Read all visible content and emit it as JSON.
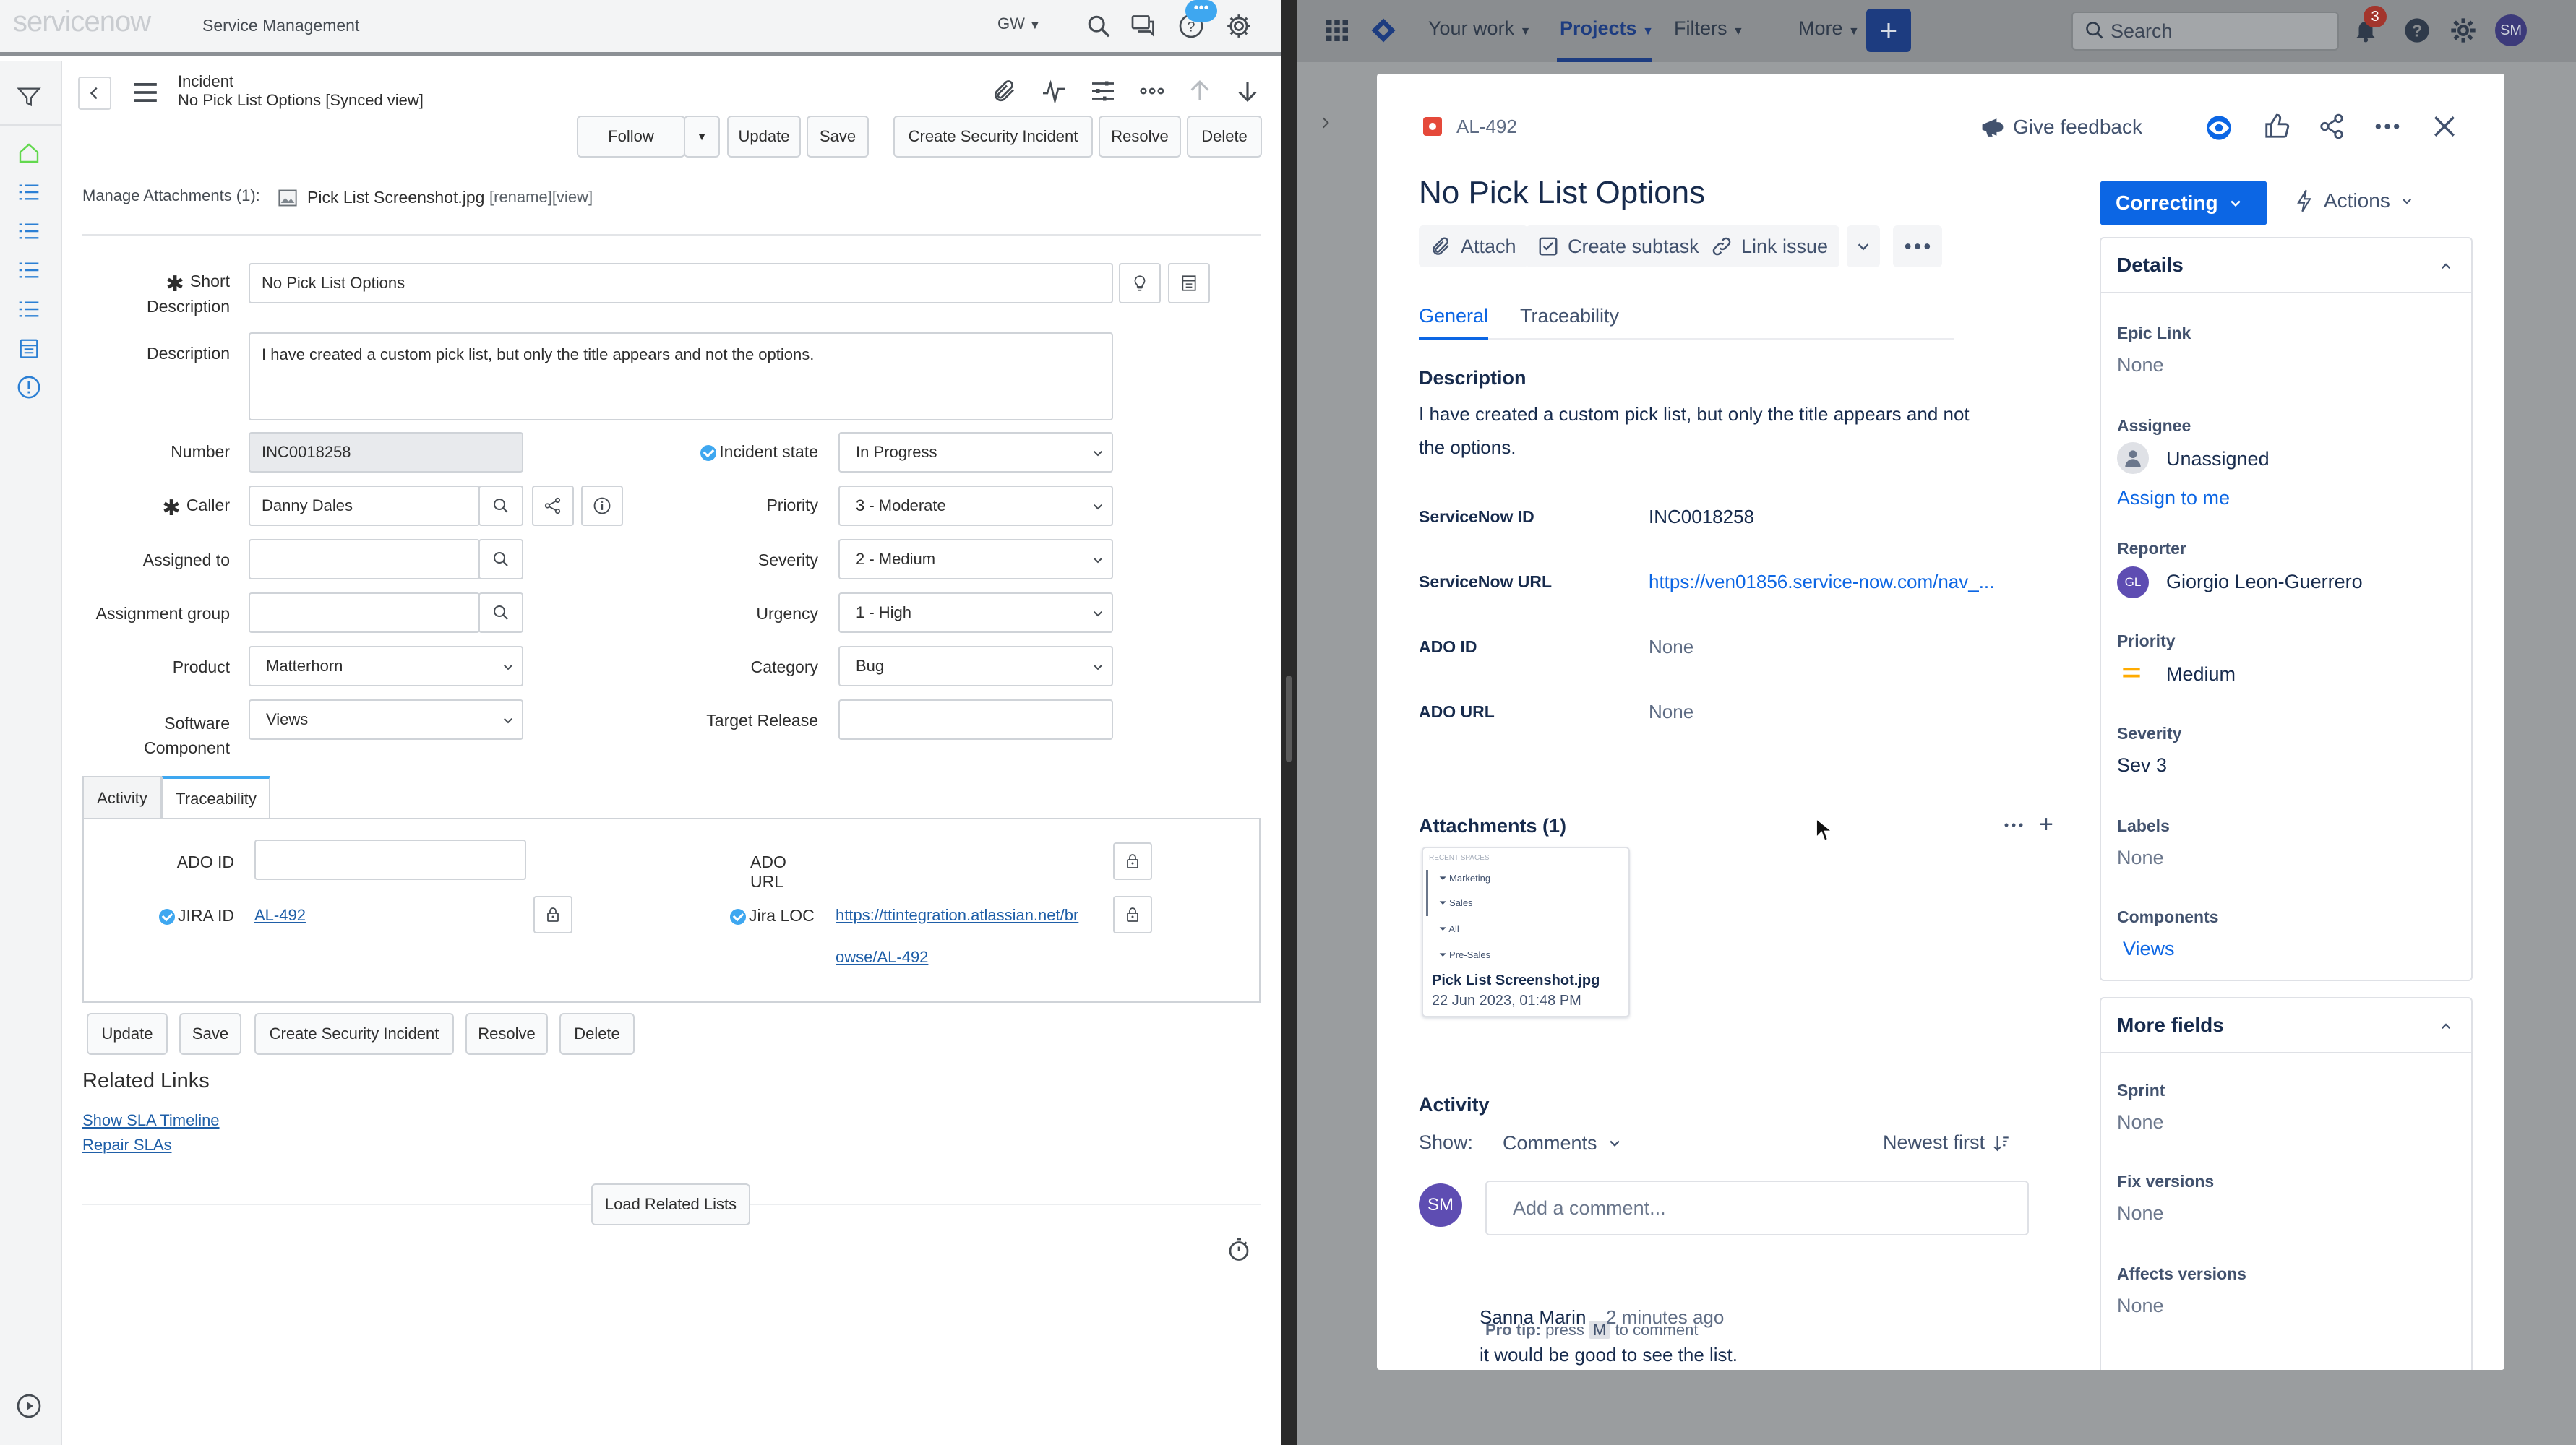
{
  "servicenow": {
    "logo": "servicenow",
    "app_title": "Service Management",
    "user_initials": "GW",
    "chat_badge": "•••",
    "record_type": "Incident",
    "record_name": "No Pick List Options [Synced view]",
    "header_buttons": {
      "follow": "Follow",
      "update": "Update",
      "save": "Save",
      "create_security_incident": "Create Security Incident",
      "resolve": "Resolve",
      "delete": "Delete"
    },
    "attachments": {
      "label": "Manage Attachments (1):",
      "file": "Pick List Screenshot.jpg",
      "actions": "[rename][view]"
    },
    "form": {
      "short_description_label": "Short Description",
      "short_description_value": "No Pick List Options",
      "description_label": "Description",
      "description_value": "I have created a custom pick list, but only the title appears and not the options.",
      "number_label": "Number",
      "number_value": "INC0018258",
      "caller_label": "Caller",
      "caller_value": "Danny Dales",
      "assigned_to_label": "Assigned to",
      "assigned_to_value": "",
      "assignment_group_label": "Assignment group",
      "assignment_group_value": "",
      "product_label": "Product",
      "product_value": "Matterhorn",
      "software_component_label": "Software Component",
      "software_component_value": "Views",
      "incident_state_label": "Incident state",
      "incident_state_value": "In Progress",
      "priority_label": "Priority",
      "priority_value": "3 - Moderate",
      "severity_label": "Severity",
      "severity_value": "2 - Medium",
      "urgency_label": "Urgency",
      "urgency_value": "1 - High",
      "category_label": "Category",
      "category_value": "Bug",
      "target_release_label": "Target Release",
      "target_release_value": ""
    },
    "tabs": [
      "Activity",
      "Traceability"
    ],
    "traceability": {
      "ado_id_label": "ADO ID",
      "ado_id_value": "",
      "ado_url_label": "ADO URL",
      "jira_id_label": "JIRA ID",
      "jira_id_value": "AL-492",
      "jira_loc_label": "Jira LOC",
      "jira_loc_line1": "https://ttintegration.atlassian.net/br",
      "jira_loc_line2": "owse/AL-492"
    },
    "bottom_buttons": {
      "update": "Update",
      "save": "Save",
      "create_security_incident": "Create Security Incident",
      "resolve": "Resolve",
      "delete": "Delete"
    },
    "related_links": {
      "title": "Related Links",
      "items": [
        "Show SLA Timeline",
        "Repair SLAs"
      ]
    },
    "load_related_lists": "Load Related Lists"
  },
  "jira": {
    "nav": {
      "your_work": "Your work",
      "projects": "Projects",
      "filters": "Filters",
      "more": "More",
      "search_placeholder": "Search",
      "notifications_count": "3",
      "user_initials": "SM"
    },
    "issue": {
      "key": "AL-492",
      "give_feedback": "Give feedback",
      "title": "No Pick List Options",
      "toolbar": {
        "attach": "Attach",
        "create_subtask": "Create subtask",
        "link_issue": "Link issue"
      },
      "tabs": [
        "General",
        "Traceability"
      ],
      "description_heading": "Description",
      "description_line1": "I have created a custom pick list, but only the title appears and not",
      "description_line2": "the options.",
      "fields": [
        {
          "label": "ServiceNow ID",
          "value": "INC0018258"
        },
        {
          "label": "ServiceNow URL",
          "value": "https://ven01856.service-now.com/nav_..."
        },
        {
          "label": "ADO ID",
          "value": "None"
        },
        {
          "label": "ADO URL",
          "value": "None"
        }
      ],
      "attachments_heading": "Attachments (1)",
      "attachment": {
        "thumb_header": "RECENT SPACES",
        "thumb_items": [
          "Marketing",
          "Sales",
          "All",
          "Pre-Sales"
        ],
        "name": "Pick List Screenshot.jpg",
        "date": "22 Jun 2023, 01:48 PM"
      },
      "activity_heading": "Activity",
      "show_label": "Show:",
      "show_value": "Comments",
      "sort_label": "Newest first",
      "comment_placeholder": "Add a comment...",
      "pro_tip_prefix": "Pro tip:",
      "pro_tip_press": "press",
      "pro_tip_key": "M",
      "pro_tip_suffix": "to comment",
      "comment": {
        "avatar": "SM",
        "author": "Sanna Marin",
        "time": "2 minutes ago",
        "text": "it would be good to see the list."
      }
    },
    "status": "Correcting",
    "actions": "Actions",
    "details": {
      "heading": "Details",
      "epic_link_label": "Epic Link",
      "epic_link_value": "None",
      "assignee_label": "Assignee",
      "assignee_value": "Unassigned",
      "assign_to_me": "Assign to me",
      "reporter_label": "Reporter",
      "reporter_initials": "GL",
      "reporter_value": "Giorgio Leon-Guerrero",
      "priority_label": "Priority",
      "priority_value": "Medium",
      "severity_label": "Severity",
      "severity_value": "Sev 3",
      "labels_label": "Labels",
      "labels_value": "None",
      "components_label": "Components",
      "components_value": "Views"
    },
    "more_fields": {
      "heading": "More fields",
      "sprint_label": "Sprint",
      "sprint_value": "None",
      "fix_versions_label": "Fix versions",
      "fix_versions_value": "None",
      "affects_versions_label": "Affects versions",
      "affects_versions_value": "None"
    },
    "colors": {
      "primary": "#0c66e4",
      "priority_medium": "#ffab00",
      "servicenow_accent": "#3ea7f0"
    }
  }
}
